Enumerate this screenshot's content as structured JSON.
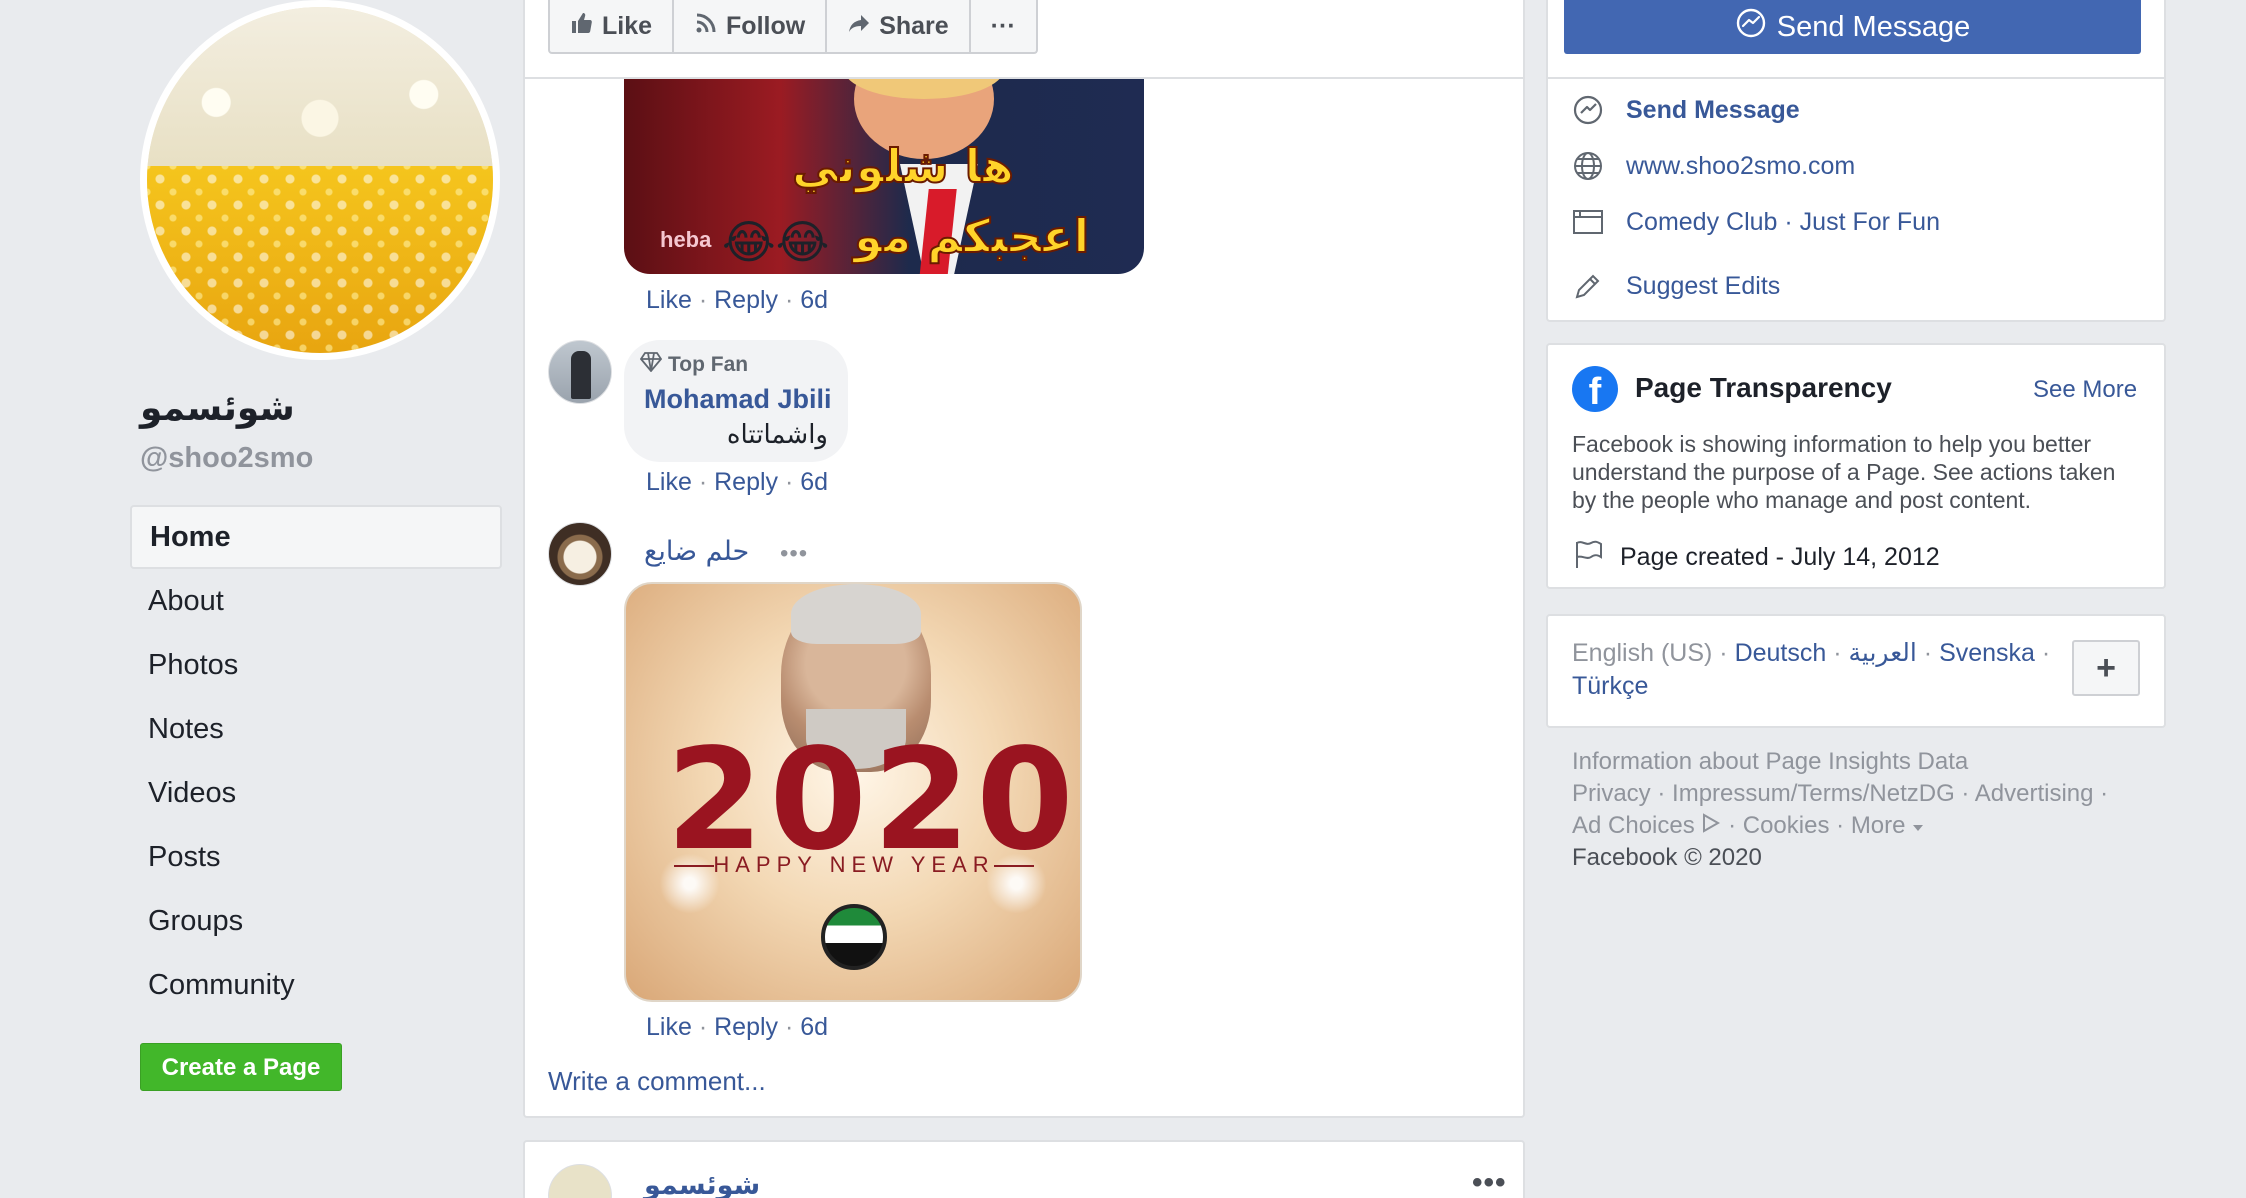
{
  "page": {
    "name": "شوئسمو",
    "handle": "@shoo2smo"
  },
  "sidebar": {
    "items": [
      {
        "label": "Home",
        "active": true
      },
      {
        "label": "About"
      },
      {
        "label": "Photos"
      },
      {
        "label": "Notes"
      },
      {
        "label": "Videos"
      },
      {
        "label": "Posts"
      },
      {
        "label": "Groups"
      },
      {
        "label": "Community"
      }
    ],
    "create_page_label": "Create a Page"
  },
  "action_bar": {
    "like_label": "Like",
    "follow_label": "Follow",
    "share_label": "Share",
    "more_label": "···"
  },
  "send_message_button": "Send Message",
  "comments": [
    {
      "image": {
        "captions": [
          "ها شلوني",
          "اعجبكم مو"
        ],
        "emoji": "😂😂",
        "watermark": "heba"
      },
      "actions": {
        "like": "Like",
        "sep1": "·",
        "reply": "Reply",
        "sep2": "·",
        "time": "6d"
      }
    },
    {
      "badge": "Top Fan",
      "author": "Mohamad Jbili",
      "text": "واشماتتاه",
      "actions": {
        "like": "Like",
        "sep1": "·",
        "reply": "Reply",
        "sep2": "·",
        "time": "6d"
      }
    },
    {
      "author": "حلم ضايع",
      "more": "•••",
      "image": {
        "year": "2020",
        "subtitle": "HAPPY NEW YEAR"
      },
      "actions": {
        "like": "Like",
        "sep1": "·",
        "reply": "Reply",
        "sep2": "·",
        "time": "6d"
      }
    }
  ],
  "write_comment_placeholder": "Write a comment...",
  "next_post": {
    "author": "شوئسمو",
    "more": "•••"
  },
  "about": {
    "rows": [
      {
        "icon": "messenger-icon",
        "label": "Send Message",
        "bold": true
      },
      {
        "icon": "globe-icon",
        "label": "www.shoo2smo.com"
      },
      {
        "icon": "category-icon",
        "label": "Comedy Club · Just For Fun"
      },
      {
        "icon": "pencil-icon",
        "label": "Suggest Edits"
      }
    ]
  },
  "transparency": {
    "title": "Page Transparency",
    "see_more": "See More",
    "description": "Facebook is showing information to help you better understand the purpose of a Page. See actions taken by the people who manage and post content.",
    "created": "Page created - July 14, 2012"
  },
  "languages": {
    "current": "English (US)",
    "options": [
      "Deutsch",
      "العربية",
      "Svenska",
      "Türkçe"
    ],
    "sep": "·",
    "add_label": "+"
  },
  "footer": {
    "line1": "Information about Page Insights Data",
    "privacy": "Privacy",
    "impressum": "Impressum/Terms/NetzDG",
    "advertising": "Advertising",
    "ad_choices": "Ad Choices",
    "cookies": "Cookies",
    "more": "More",
    "copyright": "Facebook © 2020",
    "sep": "·"
  },
  "colors": {
    "link": "#385898",
    "primary_button": "#4267b2",
    "create_button": "#42b72a",
    "background": "#e9ebee"
  }
}
